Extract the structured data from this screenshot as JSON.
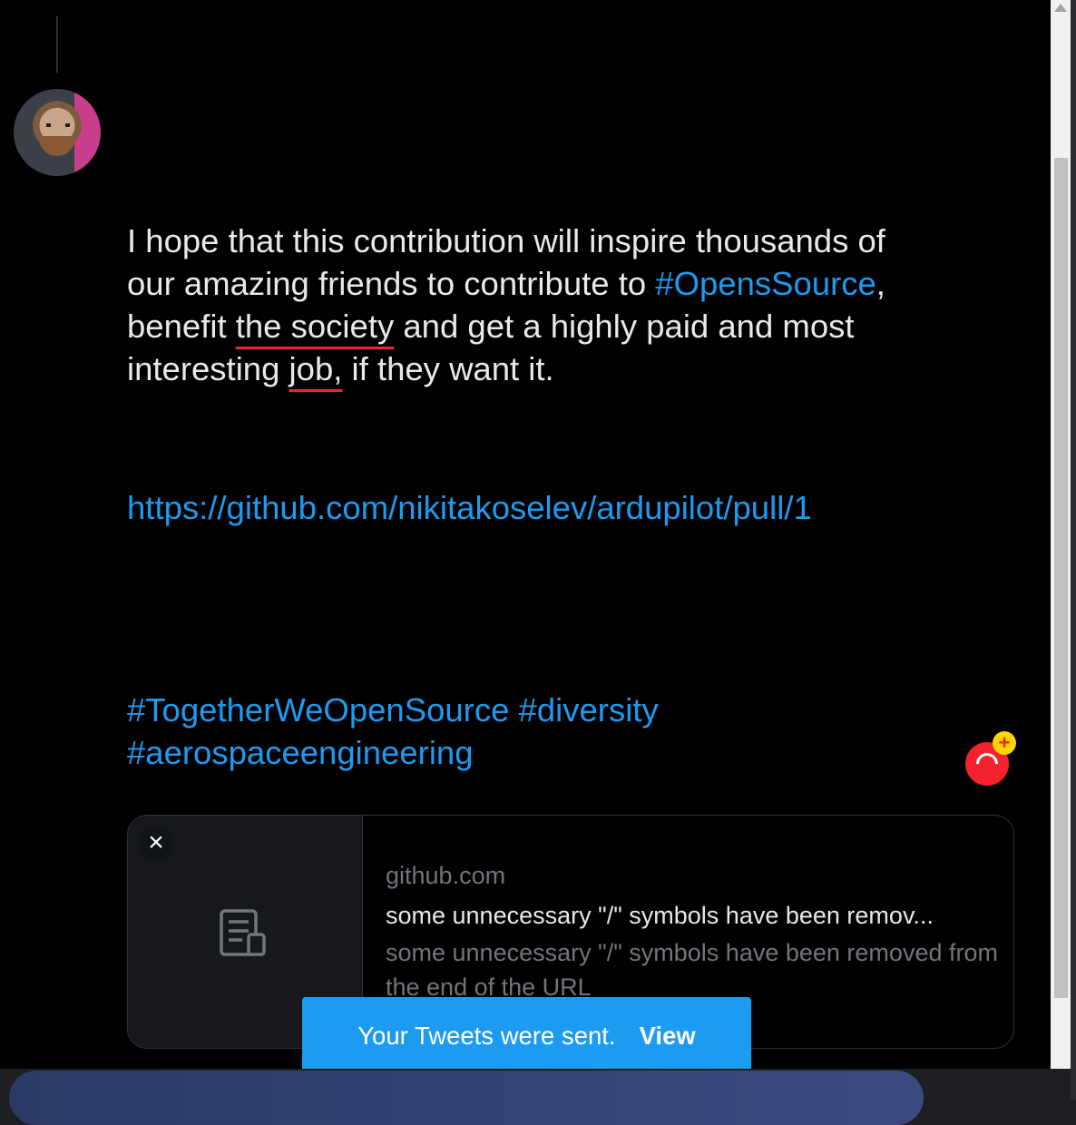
{
  "tweet": {
    "line1": "I hope that this contribution will inspire thousands of",
    "line2_prefix": "our amazing friends to contribute to ",
    "hashtag_opens_source": "#OpensSource",
    "line2_suffix": ",",
    "line3_prefix": "benefit ",
    "spell_the_society": "the society",
    "line3_suffix": " and get a highly paid and most",
    "line4_prefix": "interesting ",
    "spell_job": "job,",
    "line4_suffix": " if they want it.",
    "url": "https://github.com/nikitakoselev/ardupilot/pull/1",
    "hashtag_together": "#TogetherWeOpenSource",
    "hashtag_diversity": "#diversity",
    "hashtag_aerospace": "#aerospaceengineering"
  },
  "counter": {
    "plus": "+"
  },
  "card": {
    "close": "×",
    "domain": "github.com",
    "title": "some unnecessary \"/\" symbols have been remov...",
    "description": "some unnecessary \"/\" symbols have been removed from the end of the URL"
  },
  "toast": {
    "message": "Your Tweets were sent.",
    "action": "View"
  },
  "icons": {
    "avatar": "user-avatar",
    "card_thumb": "document-icon"
  },
  "colors": {
    "accent": "#1d9bf0",
    "spell_error": "#f4212e",
    "background": "#000000"
  }
}
